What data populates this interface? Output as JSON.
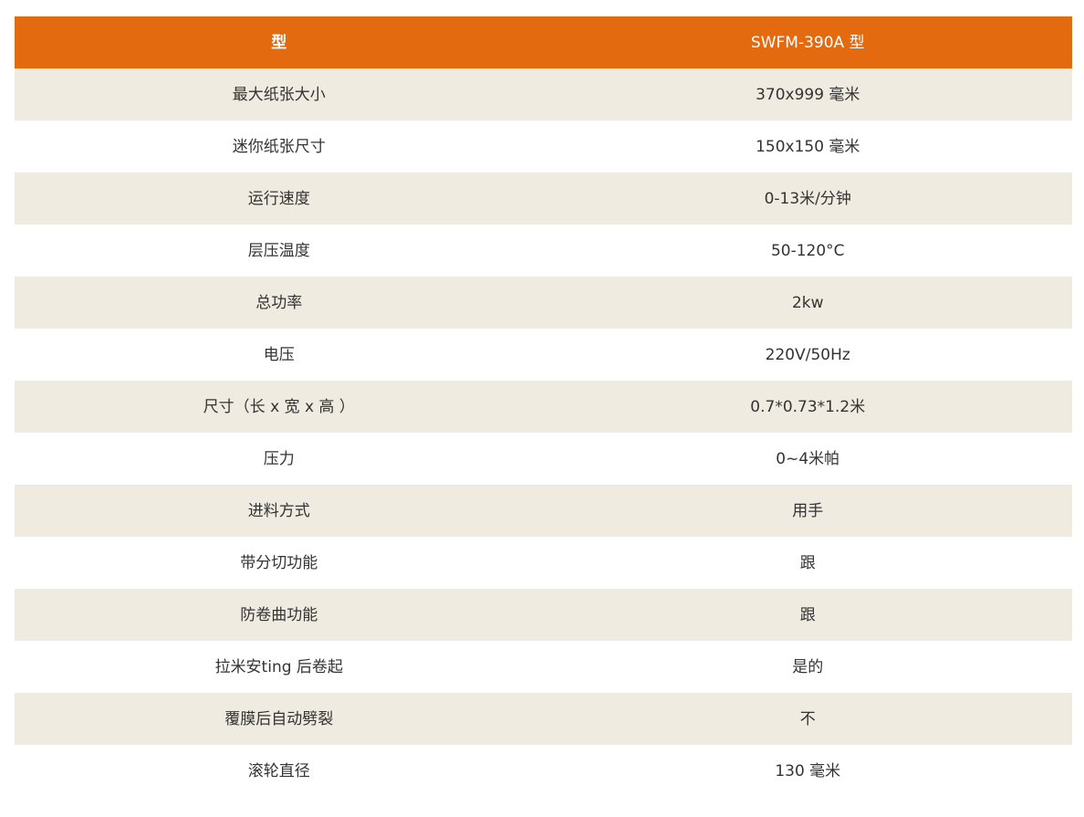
{
  "table": {
    "header": {
      "label": "型",
      "value": "SWFM-390A 型"
    },
    "rows": [
      {
        "label": "最大纸张大小",
        "value": "370x999 毫米"
      },
      {
        "label": "迷你纸张尺寸",
        "value": "150x150 毫米"
      },
      {
        "label": "运行速度",
        "value": "0-13米/分钟"
      },
      {
        "label": "层压温度",
        "value": "50-120°C"
      },
      {
        "label": "总功率",
        "value": "2kw"
      },
      {
        "label": "电压",
        "value": "220V/50Hz"
      },
      {
        "label": "尺寸（长 x 宽 x 高 ）",
        "value": "0.7*0.73*1.2米"
      },
      {
        "label": "压力",
        "value": "0~4米帕"
      },
      {
        "label": "进料方式",
        "value": "用手"
      },
      {
        "label": "带分切功能",
        "value": "跟"
      },
      {
        "label": "防卷曲功能",
        "value": "跟"
      },
      {
        "label": "拉米安ting 后卷起",
        "value": "是的"
      },
      {
        "label": "覆膜后自动劈裂",
        "value": "不"
      },
      {
        "label": "滚轮直径",
        "value": "130 毫米"
      }
    ]
  },
  "colors": {
    "header_bg": "#e36a0f",
    "stripe_bg": "#efebe0",
    "row_bg": "#ffffff"
  }
}
